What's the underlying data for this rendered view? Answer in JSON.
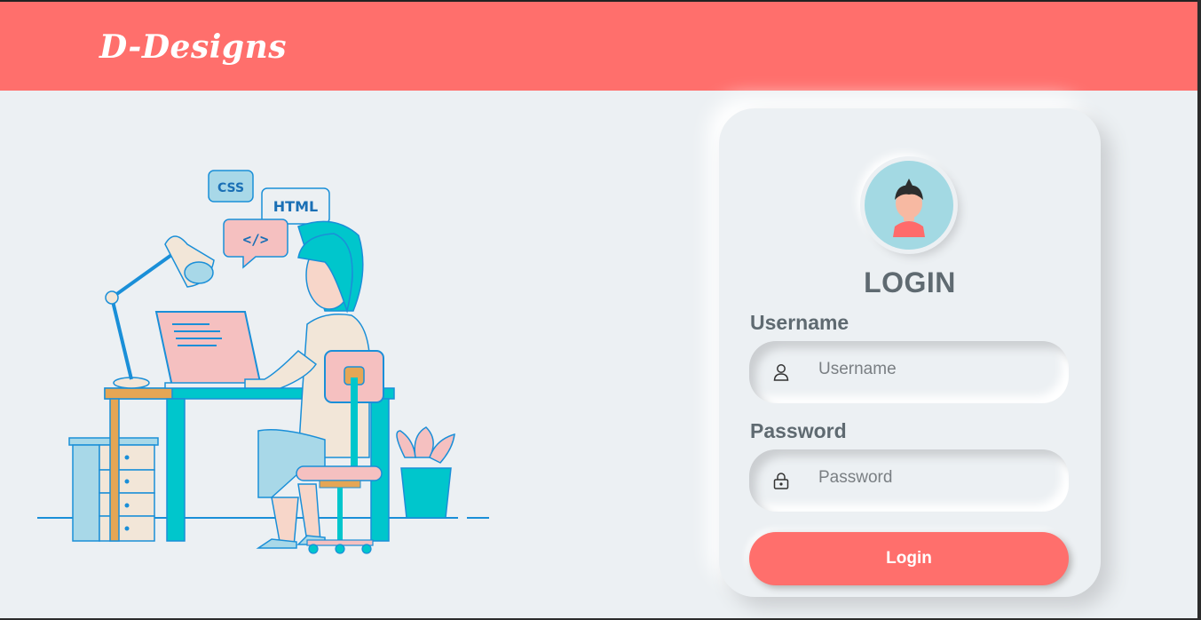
{
  "header": {
    "brand": "D-Designs"
  },
  "illustration": {
    "bubble_css": "CSS",
    "bubble_html": "HTML",
    "bubble_code": "</>"
  },
  "login": {
    "title": "LOGIN",
    "username_label": "Username",
    "username_placeholder": "Username",
    "password_label": "Password",
    "password_placeholder": "Password",
    "button_label": "Login"
  },
  "colors": {
    "accent": "#ff6f6c",
    "background": "#ecf0f3",
    "text": "#5f6a71"
  },
  "icons": [
    "user-icon",
    "lock-icon"
  ]
}
